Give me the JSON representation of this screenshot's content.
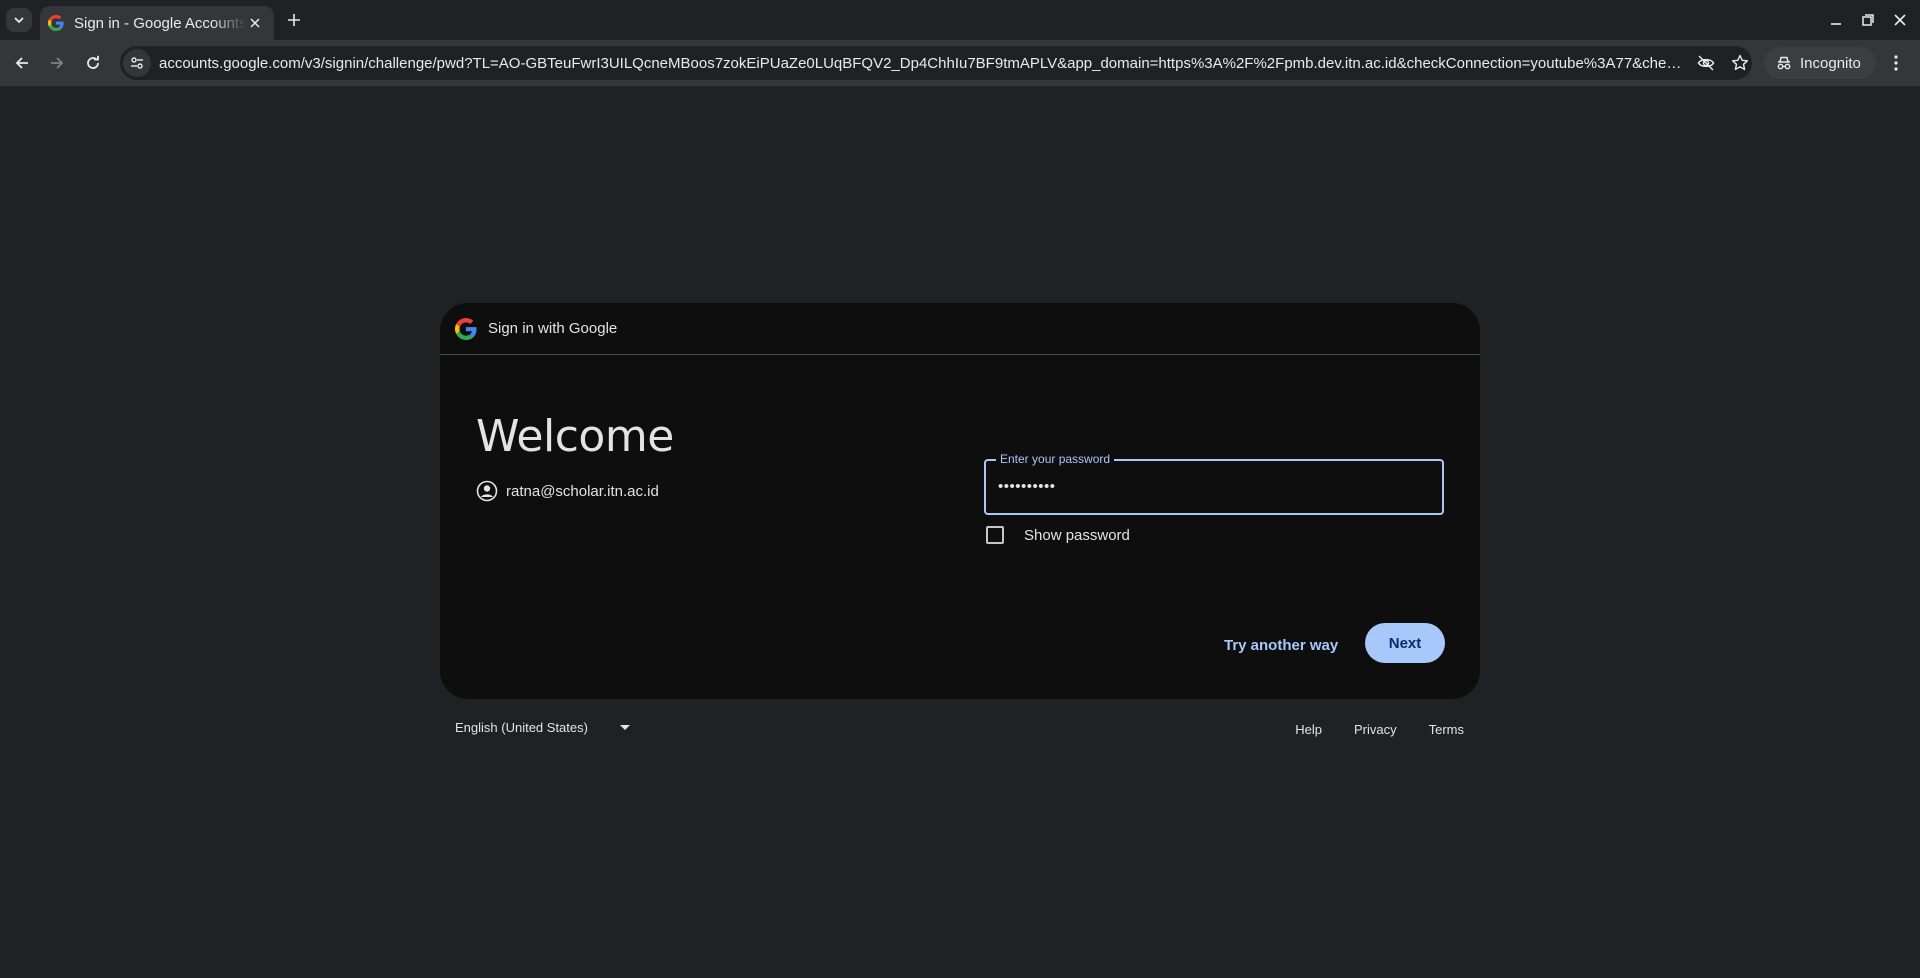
{
  "browser": {
    "tab": {
      "title": "Sign in - Google Accounts"
    },
    "address_bar": {
      "url": "accounts.google.com/v3/signin/challenge/pwd?TL=AO-GBTeuFwrI3UILQcneMBoos7zokEiPUaZe0LUqBFQV2_Dp4ChhIu7BF9tmAPLV&app_domain=https%3A%2F%2Fpmb.dev.itn.ac.id&checkConnection=youtube%3A77&checkedDomains=..."
    },
    "profile": {
      "label": "Incognito"
    }
  },
  "signin": {
    "header_text": "Sign in with Google",
    "heading": "Welcome",
    "account_email": "ratna@scholar.itn.ac.id",
    "password_label": "Enter your password",
    "password_value": "••••••••••",
    "show_password_label": "Show password",
    "show_password_checked": false,
    "try_another_way_label": "Try another way",
    "next_label": "Next"
  },
  "footer": {
    "language": "English (United States)",
    "links": [
      "Help",
      "Privacy",
      "Terms"
    ]
  },
  "colors": {
    "page_bg": "#202124",
    "card_bg": "#0e0e0e",
    "accent": "#a8c7fa",
    "next_text": "#062e6f"
  },
  "icons": [
    "tab-search-icon",
    "google-favicon-icon",
    "close-icon",
    "plus-icon",
    "minimize-icon",
    "restore-icon",
    "window-close-icon",
    "back-icon",
    "forward-icon",
    "reload-icon",
    "site-info-icon",
    "eye-off-icon",
    "star-icon",
    "incognito-icon",
    "kebab-menu-icon",
    "google-logo-icon",
    "account-circle-icon",
    "caret-down-icon"
  ]
}
